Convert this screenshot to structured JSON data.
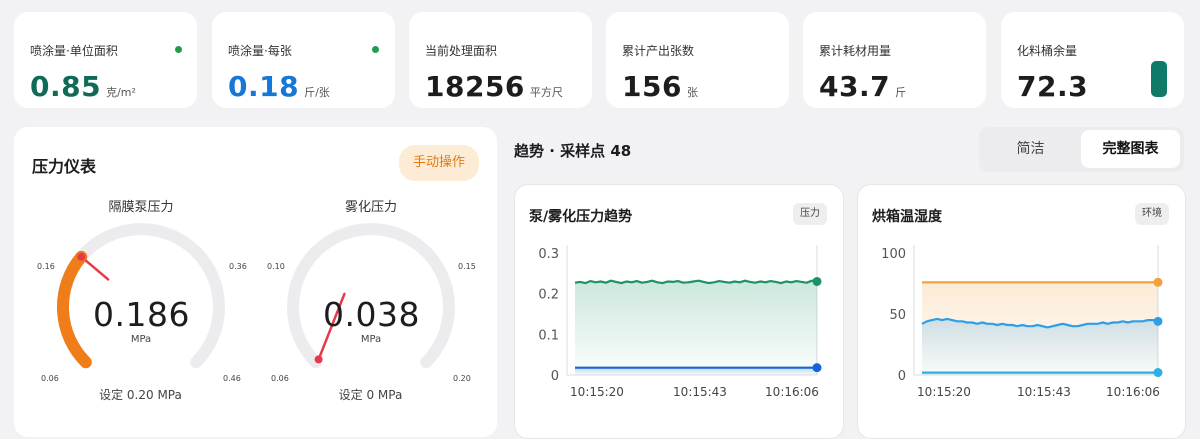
{
  "stats": [
    {
      "label": "喷涂量·单位面积",
      "value": "0.85",
      "unit": "克/m²",
      "color": "#0f6b57"
    },
    {
      "label": "喷涂量·每张",
      "value": "0.18",
      "unit": "斤/张",
      "color": "#1677d6"
    },
    {
      "label": "当前处理面积",
      "value": "18256",
      "unit": "平方尺",
      "color": "#1d1d1f"
    },
    {
      "label": "累计产出张数",
      "value": "156",
      "unit": "张",
      "color": "#1d1d1f"
    },
    {
      "label": "累计耗材用量",
      "value": "43.7",
      "unit": "斤",
      "color": "#1d1d1f"
    },
    {
      "label": "化料桶余量",
      "value": "72.3",
      "unit": "",
      "color": "#1d1d1f"
    }
  ],
  "gauges": {
    "title": "压力仪表",
    "manual_button": "手动操作",
    "pump": {
      "title": "隔膜泵压力",
      "value": "0.186",
      "unit": "MPa",
      "setpoint": "设定 0.20 MPa",
      "ticks": [
        "0.06",
        "0.16",
        "0.36",
        "0.46"
      ],
      "min": 0.06,
      "max": 0.46,
      "reading": 0.186,
      "color": "#ee7d1a"
    },
    "atomize": {
      "title": "雾化压力",
      "value": "0.038",
      "unit": "MPa",
      "setpoint": "设定 0 MPa",
      "ticks": [
        "0.06",
        "0.10",
        "0.15",
        "0.20"
      ],
      "min": 0,
      "max": 0.2,
      "reading": 0.038,
      "color": "#cccccc"
    }
  },
  "trend": {
    "header": "趋势 · 采样点 48",
    "modes": [
      "简洁",
      "完整图表"
    ],
    "active_mode": "完整图表"
  },
  "charts": {
    "pressure": {
      "title": "泵/雾化压力趋势",
      "tag": "压力"
    },
    "env": {
      "title": "烘箱温湿度",
      "tag": "环境"
    }
  },
  "chart_data": [
    {
      "type": "line",
      "title": "泵/雾化压力趋势",
      "x_ticks": [
        "10:15:20",
        "10:15:43",
        "10:16:06"
      ],
      "y_ticks": [
        "0.3",
        "0.2",
        "0.1",
        "0"
      ],
      "ylim": [
        0,
        0.3
      ],
      "series": [
        {
          "color": "#1a9464",
          "values": [
            0.227,
            0.229,
            0.226,
            0.231,
            0.228,
            0.23,
            0.227,
            0.232,
            0.229,
            0.226,
            0.23,
            0.228,
            0.231,
            0.227,
            0.229,
            0.232,
            0.228,
            0.226,
            0.23,
            0.229,
            0.231,
            0.227,
            0.228,
            0.23,
            0.232,
            0.229,
            0.226,
            0.228,
            0.231,
            0.229,
            0.227,
            0.23,
            0.228,
            0.232,
            0.229,
            0.227,
            0.23,
            0.228,
            0.231,
            0.229,
            0.226,
            0.23,
            0.228,
            0.231,
            0.229,
            0.227,
            0.232,
            0.23
          ]
        },
        {
          "color": "#1565d8",
          "values": [
            0.018,
            0.018,
            0.018,
            0.018,
            0.018,
            0.018,
            0.018,
            0.018,
            0.018,
            0.018,
            0.018,
            0.018,
            0.018,
            0.018,
            0.018,
            0.018,
            0.018,
            0.018,
            0.018,
            0.018,
            0.018,
            0.018,
            0.018,
            0.018,
            0.018,
            0.018,
            0.018,
            0.018,
            0.018,
            0.018,
            0.018,
            0.018,
            0.018,
            0.018,
            0.018,
            0.018,
            0.018,
            0.018,
            0.018,
            0.018,
            0.018,
            0.018,
            0.018,
            0.018,
            0.018,
            0.018,
            0.018,
            0.018
          ]
        }
      ]
    },
    {
      "type": "line",
      "title": "烘箱温湿度",
      "x_ticks": [
        "10:15:20",
        "10:15:43",
        "10:16:06"
      ],
      "y_ticks": [
        "100",
        "50",
        "0"
      ],
      "ylim": [
        0,
        100
      ],
      "series": [
        {
          "color": "#f0a13a",
          "values": [
            76,
            76,
            76,
            76,
            76,
            76,
            76,
            76,
            76,
            76,
            76,
            76,
            76,
            76,
            76,
            76,
            76,
            76,
            76,
            76,
            76,
            76,
            76,
            76,
            76,
            76,
            76,
            76,
            76,
            76,
            76,
            76,
            76,
            76,
            76,
            76,
            76,
            76,
            76,
            76,
            76,
            76,
            76,
            76,
            76,
            76,
            76,
            76
          ]
        },
        {
          "color": "#2d9ee8",
          "values": [
            42,
            44,
            45,
            46,
            45,
            46,
            45,
            44,
            44,
            43,
            43,
            42,
            43,
            42,
            42,
            41,
            42,
            41,
            41,
            40,
            41,
            40,
            40,
            41,
            40,
            39,
            40,
            41,
            42,
            41,
            40,
            40,
            41,
            42,
            42,
            42,
            43,
            42,
            43,
            43,
            44,
            43,
            44,
            44,
            44,
            45,
            45,
            44
          ]
        },
        {
          "color": "#2dafe5",
          "values": [
            2,
            2,
            2,
            2,
            2,
            2,
            2,
            2,
            2,
            2,
            2,
            2,
            2,
            2,
            2,
            2,
            2,
            2,
            2,
            2,
            2,
            2,
            2,
            2,
            2,
            2,
            2,
            2,
            2,
            2,
            2,
            2,
            2,
            2,
            2,
            2,
            2,
            2,
            2,
            2,
            2,
            2,
            2,
            2,
            2,
            2,
            2,
            2
          ]
        }
      ]
    }
  ]
}
